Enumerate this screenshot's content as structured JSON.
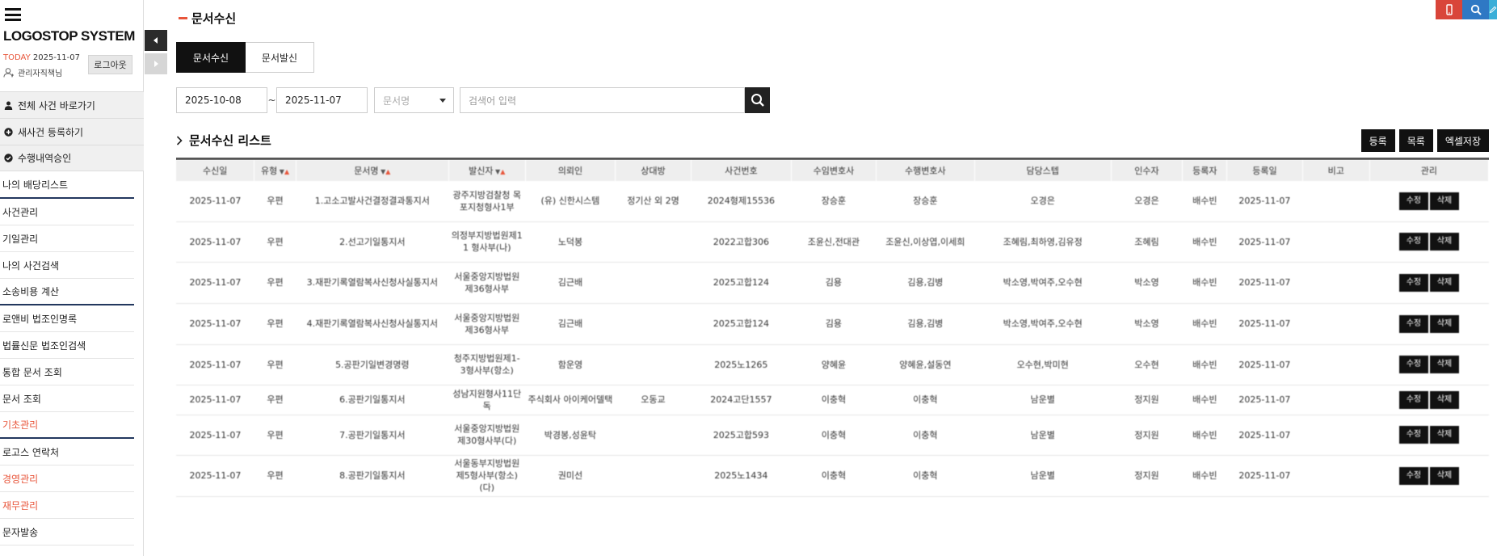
{
  "sidebar": {
    "brand": "LOGOSTOP SYSTEM",
    "today_label": "TODAY",
    "today_date": "2025-11-07",
    "user_name": "관리자직책님",
    "logout_label": "로그아웃",
    "quick_links": [
      {
        "label": "전체 사건 바로가기",
        "icon": "person-icon"
      },
      {
        "label": "새사건 등록하기",
        "icon": "plus-circle-icon"
      },
      {
        "label": "수행내역승인",
        "icon": "check-circle-icon"
      }
    ],
    "menu": [
      {
        "label": "나의 배당리스트",
        "style": "sect"
      },
      {
        "label": "사건관리",
        "style": ""
      },
      {
        "label": "기일관리",
        "style": ""
      },
      {
        "label": "나의 사건검색",
        "style": ""
      },
      {
        "label": "소송비용 계산",
        "style": "sect"
      },
      {
        "label": "로앤비 법조인명록",
        "style": ""
      },
      {
        "label": "법률신문 법조인검색",
        "style": ""
      },
      {
        "label": "통합 문서 조회",
        "style": ""
      },
      {
        "label": "문서 조회",
        "style": ""
      },
      {
        "label": "기초관리",
        "style": "orange sect"
      },
      {
        "label": "로고스 연락처",
        "style": ""
      },
      {
        "label": "경영관리",
        "style": "orange"
      },
      {
        "label": "재무관리",
        "style": "orange"
      },
      {
        "label": "문자발송",
        "style": ""
      }
    ]
  },
  "page": {
    "title": "문서수신",
    "tabs": [
      "문서수신",
      "문서발신"
    ],
    "date_from": "2025-10-08",
    "date_sep": "~",
    "date_to": "2025-11-07",
    "select_placeholder": "문서명",
    "keyword_placeholder": "검색어 입력",
    "list_title": "문서수신 리스트",
    "actions": [
      "등록",
      "목록",
      "엑셀저장"
    ]
  },
  "table": {
    "headers": [
      "수신일",
      "유형",
      "문서명",
      "발신자",
      "의뢰인",
      "상대방",
      "사건번호",
      "수임변호사",
      "수행변호사",
      "담당스텝",
      "인수자",
      "등록자",
      "등록일",
      "비고",
      "관리"
    ],
    "sortable": [
      1,
      2,
      3
    ],
    "row_buttons": [
      "수정",
      "삭제"
    ],
    "rows": [
      [
        "2025-11-07",
        "우편",
        "1.고소고발사건결정결과통지서",
        "광주지방검찰청 목포지청형사1부",
        "(유) 신한시스템",
        "정기산 외 2명",
        "2024형제15536",
        "장승훈",
        "장승훈",
        "오경은",
        "오경은",
        "배수빈",
        "2025-11-07",
        ""
      ],
      [
        "2025-11-07",
        "우편",
        "2.선고기일통지서",
        "의정부지방법원제11 형사부(나)",
        "노덕봉",
        "",
        "2022고합306",
        "조윤신,전대관",
        "조윤신,이상엽,이세희",
        "조혜림,최하영,김유정",
        "조혜림",
        "배수빈",
        "2025-11-07",
        ""
      ],
      [
        "2025-11-07",
        "우편",
        "3.재판기록열람복사신청사실통지서",
        "서울중앙지방법원제36형사부",
        "김근배",
        "",
        "2025고합124",
        "김용",
        "김용,김병",
        "박소영,박여주,오수현",
        "박소영",
        "배수빈",
        "2025-11-07",
        ""
      ],
      [
        "2025-11-07",
        "우편",
        "4.재판기록열람복사신청사실통지서",
        "서울중앙지방법원제36형사부",
        "김근배",
        "",
        "2025고합124",
        "김용",
        "김용,김병",
        "박소영,박여주,오수현",
        "박소영",
        "배수빈",
        "2025-11-07",
        ""
      ],
      [
        "2025-11-07",
        "우편",
        "5.공판기일변경명령",
        "청주지방법원제1-3형사부(항소)",
        "함운영",
        "",
        "2025노1265",
        "양혜윤",
        "양혜윤,설동연",
        "오수현,박미현",
        "오수현",
        "배수빈",
        "2025-11-07",
        ""
      ],
      [
        "2025-11-07",
        "우편",
        "6.공판기일통지서",
        "성남지원형사11단독",
        "주식회사 아이케어델택",
        "오동교",
        "2024고단1557",
        "이충혁",
        "이충혁",
        "남운별",
        "정지원",
        "배수빈",
        "2025-11-07",
        ""
      ],
      [
        "2025-11-07",
        "우편",
        "7.공판기일통지서",
        "서울중앙지방법원제30형사부(다)",
        "박경봉,성윤탁",
        "",
        "2025고합593",
        "이충혁",
        "이충혁",
        "남운별",
        "정지원",
        "배수빈",
        "2025-11-07",
        ""
      ],
      [
        "2025-11-07",
        "우편",
        "8.공판기일통지서",
        "서울동부지방법원제5형사부(항소)(다)",
        "권미선",
        "",
        "2025노1434",
        "이충혁",
        "이충혁",
        "남운별",
        "정지원",
        "배수빈",
        "2025-11-07",
        ""
      ]
    ]
  },
  "colors": {
    "accent": "#e8553a",
    "dark": "#111111",
    "float_red": "#d9453a",
    "float_blue": "#2f78c4",
    "float_cyan": "#3aaed8"
  }
}
